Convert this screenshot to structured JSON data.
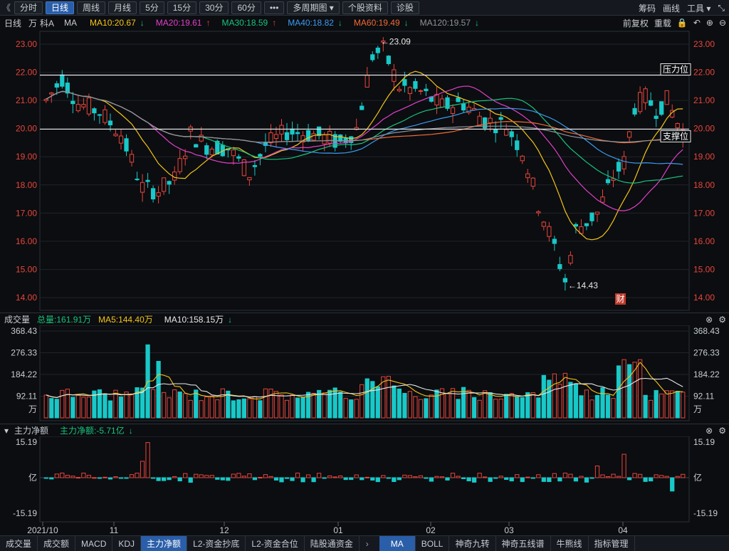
{
  "toolbar": {
    "back_icon": "chevron-left-icon",
    "periods": [
      "分时",
      "日线",
      "周线",
      "月线",
      "5分",
      "15分",
      "30分",
      "60分"
    ],
    "active_period": 1,
    "more_label": "•••",
    "multi_period_label": "多周期图",
    "stock_info_label": "个股资料",
    "diagnose_label": "诊股",
    "right": [
      "筹码",
      "画线",
      "工具 ▾",
      "⤡"
    ]
  },
  "legend": {
    "period": "日线",
    "adj1": "万",
    "name": "科A",
    "ma_label": "MA",
    "items": [
      {
        "text": "MA10:20.67",
        "arrow": "↓",
        "color": "#f5c518"
      },
      {
        "text": "MA20:19.61",
        "arrow": "↑",
        "color": "#e040c8"
      },
      {
        "text": "MA30:18.59",
        "arrow": "↑",
        "color": "#19c37d"
      },
      {
        "text": "MA40:18.82",
        "arrow": "↓",
        "color": "#3a9bf0"
      },
      {
        "text": "MA60:19.49",
        "arrow": "↓",
        "color": "#f06a35"
      },
      {
        "text": "MA120:19.57",
        "arrow": "↓",
        "color": "#8d939b"
      }
    ],
    "right": [
      "前复权",
      "重载",
      "🔒",
      "↶",
      "⊕",
      "⊖"
    ]
  },
  "price_axis": [
    "23.00",
    "22.00",
    "21.00",
    "20.00",
    "19.00",
    "18.00",
    "17.00",
    "16.00",
    "15.00",
    "14.00"
  ],
  "annotations": {
    "high_label": "23.09",
    "low_label": "14.43",
    "resistance_label": "压力位",
    "support_label": "支撑位",
    "cai_label": "财"
  },
  "volume": {
    "title": "成交量",
    "total": "总量:161.91万",
    "ma5": "MA5:144.40万",
    "ma10": "MA10:158.15万",
    "ma10_arrow": "↓",
    "axis": [
      "368.43",
      "276.33",
      "184.22",
      "92.11",
      "万"
    ]
  },
  "netflow": {
    "title": "主力净额",
    "value": "主力净额:-5.71亿",
    "value_arrow": "↓",
    "axis": [
      "15.19",
      "亿",
      "-15.19"
    ]
  },
  "date_axis": [
    "2021/10",
    "11",
    "12",
    "01",
    "02",
    "03",
    "04"
  ],
  "bottom_tabs": [
    "成交量",
    "成交额",
    "MACD",
    "KDJ",
    "主力净额",
    "L2-资金抄底",
    "L2-资金合位",
    "陆股通资金"
  ],
  "bottom_tabs_active": 4,
  "bottom_tabs_right": [
    "MA",
    "BOLL",
    "神奇九转",
    "神奇五线谱",
    "牛熊线",
    "指标管理"
  ],
  "bottom_tabs_right_active": 0,
  "colors": {
    "up": "#e8453c",
    "down": "#19c8c8",
    "resistance": "#e8e8e8",
    "grid": "#1f242b"
  }
}
